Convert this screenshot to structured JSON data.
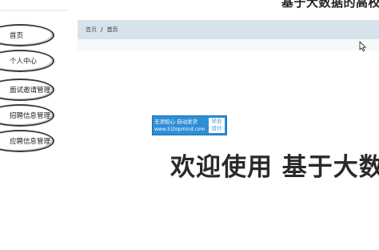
{
  "header": {
    "system_title": "基于大数据的高校就业"
  },
  "sidebar": {
    "items": [
      {
        "label": "首页"
      },
      {
        "label": "个人中心"
      },
      {
        "label": "面试邀请管理"
      },
      {
        "label": "招聘信息管理"
      },
      {
        "label": "应聘信息管理"
      }
    ]
  },
  "breadcrumb": {
    "items": [
      "首页",
      "首页"
    ],
    "separator": "/"
  },
  "watermark": {
    "line1": "无须担心·自动发货",
    "line2": "www.51topmind.com",
    "side_top": "毕业",
    "side_bottom": "设计"
  },
  "main": {
    "welcome_text": "欢迎使用 基于大数据的高校就业"
  },
  "colors": {
    "breadcrumb_bg": "#d7e3ea",
    "watermark_bg": "#2d8fd6",
    "sidebar_border": "#3b3b3b"
  },
  "icons": [
    "mouse-cursor-icon"
  ]
}
